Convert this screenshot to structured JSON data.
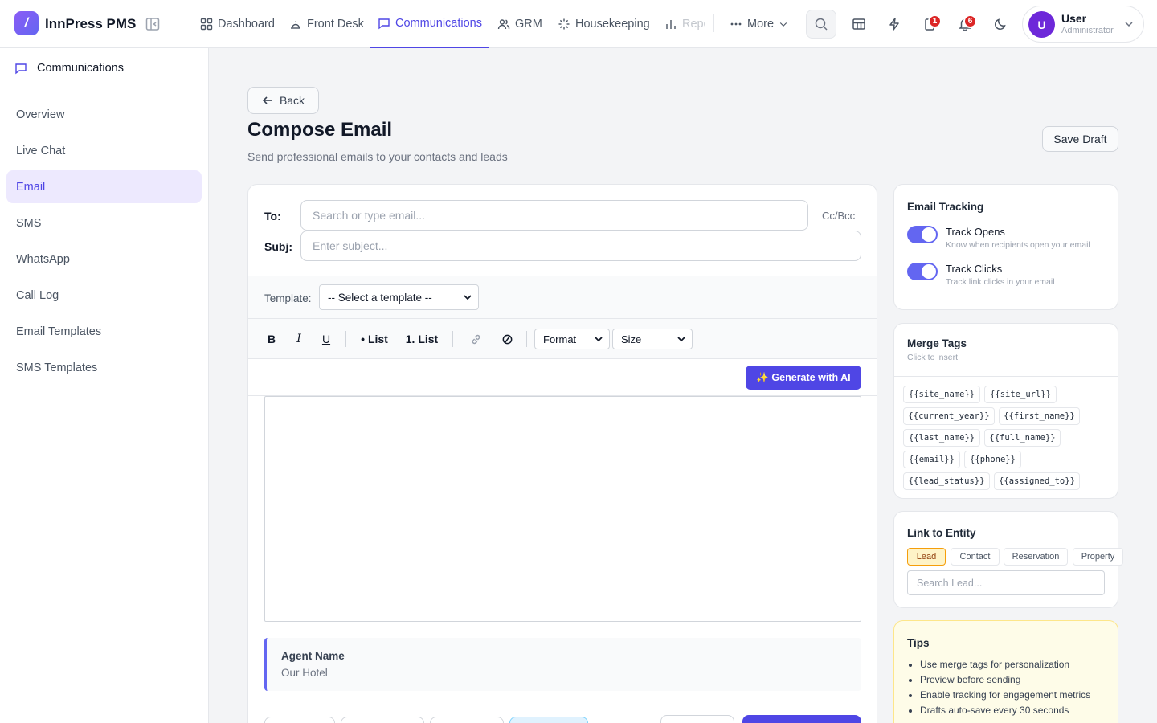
{
  "app": {
    "logo_glyph": "/",
    "brand": "InnPress PMS"
  },
  "nav": [
    {
      "label": "Dashboard",
      "icon": "grid-icon"
    },
    {
      "label": "Front Desk",
      "icon": "bell-desk-icon"
    },
    {
      "label": "Communications",
      "icon": "chat-icon",
      "active": true
    },
    {
      "label": "GRM",
      "icon": "users-icon"
    },
    {
      "label": "Housekeeping",
      "icon": "sparkle-icon"
    },
    {
      "label": "Repo",
      "icon": "bar-chart-icon"
    }
  ],
  "nav_more": "More",
  "header_badges": {
    "notes": "1",
    "bell": "6"
  },
  "user": {
    "initial": "U",
    "name": "User",
    "role": "Administrator"
  },
  "sidebar": {
    "title": "Communications",
    "items": [
      "Overview",
      "Live Chat",
      "Email",
      "SMS",
      "WhatsApp",
      "Call Log",
      "Email Templates",
      "SMS Templates"
    ],
    "active": "Email"
  },
  "page": {
    "back": "Back",
    "title": "Compose Email",
    "subtitle": "Send professional emails to your contacts and leads",
    "save_draft": "Save Draft"
  },
  "compose": {
    "to_label": "To:",
    "to_placeholder": "Search or type email...",
    "cc_bcc": "Cc/Bcc",
    "subject_label": "Subj:",
    "subject_placeholder": "Enter subject...",
    "template_label": "Template:",
    "template_value": "-- Select a template --",
    "toolbar": {
      "bold": "B",
      "italic": "I",
      "underline": "U",
      "bullet_list": "• List",
      "numbered_list": "1. List",
      "format": "Format",
      "size": "Size"
    },
    "ai_button": "✨ Generate with AI",
    "signature": {
      "name": "Agent Name",
      "org": "Our Hotel"
    }
  },
  "tracking": {
    "title": "Email Tracking",
    "opens": {
      "label": "Track Opens",
      "desc": "Know when recipients open your email",
      "on": true
    },
    "clicks": {
      "label": "Track Clicks",
      "desc": "Track link clicks in your email",
      "on": true
    }
  },
  "merge_tags": {
    "title": "Merge Tags",
    "hint": "Click to insert",
    "tags": [
      "{{site_name}}",
      "{{site_url}}",
      "{{current_year}}",
      "{{first_name}}",
      "{{last_name}}",
      "{{full_name}}",
      "{{email}}",
      "{{phone}}",
      "{{lead_status}}",
      "{{assigned_to}}"
    ]
  },
  "link_entity": {
    "title": "Link to Entity",
    "tabs": [
      "Lead",
      "Contact",
      "Reservation",
      "Property"
    ],
    "active": "Lead",
    "search_placeholder": "Search Lead..."
  },
  "tips": {
    "title": "Tips",
    "items": [
      "Use merge tags for personalization",
      "Preview before sending",
      "Enable tracking for engagement metrics",
      "Drafts auto-save every 30 seconds"
    ]
  },
  "colors": {
    "accent": "#4f46e5",
    "accent_light": "#ede9fe",
    "badge": "#dc2626",
    "tips_bg": "#fefce8"
  }
}
